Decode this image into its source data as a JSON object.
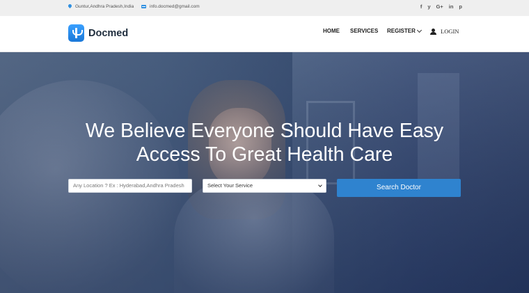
{
  "topbar": {
    "address": "Guntur,Andhra Pradesh,India",
    "email": "info.docmed@gmail.com",
    "social": [
      "facebook-icon",
      "twitter-icon",
      "google-plus-icon",
      "linkedin-icon",
      "pinterest-icon"
    ],
    "social_glyphs": [
      "f",
      "y",
      "G+",
      "in",
      "p"
    ]
  },
  "brand": {
    "name": "Docmed",
    "accent": "#2e8fe0"
  },
  "nav": {
    "home": "HOME",
    "services": "SERVICES",
    "register": "REGISTER",
    "login": "LOGIN"
  },
  "hero": {
    "headline_line1": "We Believe Everyone Should Have Easy",
    "headline_line2": "Access To Great Health Care"
  },
  "search": {
    "location_placeholder": "Any Location ?  Ex : Hyderabad,Andhra Pradesh",
    "service_selected": "Select Your Service",
    "button_label": "Search Doctor",
    "button_color": "#2f83cf"
  }
}
